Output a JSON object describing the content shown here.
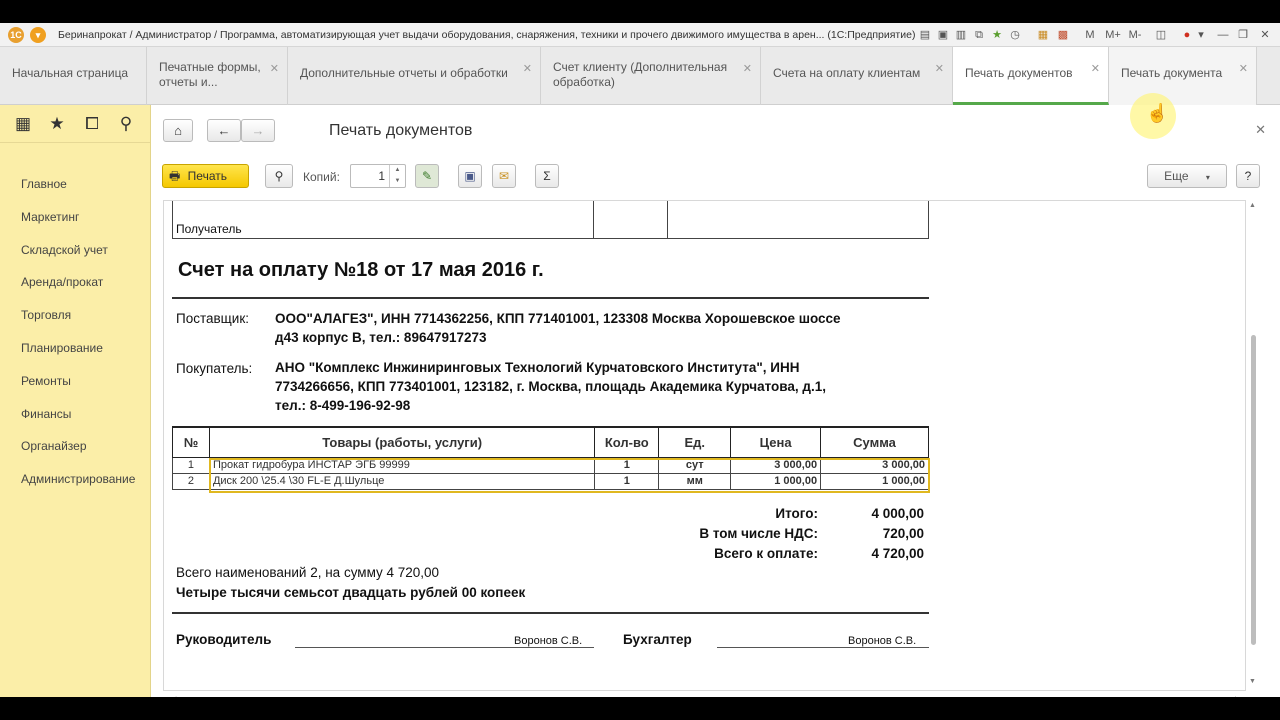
{
  "window": {
    "title": "Беринапрокат / Администратор / Программа, автоматизирующая учет выдачи оборудования, снаряжения, техники и прочего движимого имущества в арен... (1С:Предприятие)",
    "title_icons": [
      "M",
      "M+",
      "M-"
    ]
  },
  "tabs": [
    {
      "label": "Начальная страница"
    },
    {
      "label": "Печатные формы, отчеты и..."
    },
    {
      "label": "Дополнительные отчеты и обработки"
    },
    {
      "label": "Счет клиенту (Дополнительная обработка)"
    },
    {
      "label": "Счета на оплату клиентам"
    },
    {
      "label": "Печать документов"
    },
    {
      "label": "Печать документа"
    }
  ],
  "sidebar": {
    "items": [
      {
        "label": "Главное"
      },
      {
        "label": "Маркетинг"
      },
      {
        "label": "Складской учет"
      },
      {
        "label": "Аренда/прокат"
      },
      {
        "label": "Торговля"
      },
      {
        "label": "Планирование"
      },
      {
        "label": "Ремонты"
      },
      {
        "label": "Финансы"
      },
      {
        "label": "Органайзер"
      },
      {
        "label": "Администрирование"
      }
    ]
  },
  "form": {
    "title": "Печать документов",
    "print_label": "Печать",
    "copies_label": "Копий:",
    "copies_value": "1",
    "more_label": "Еще",
    "help_label": "?"
  },
  "document": {
    "recipient_label": "Получатель",
    "heading": "Счет на оплату №18 от 17 мая 2016 г.",
    "supplier_label": "Поставщик:",
    "supplier_line1": "ООО\"АЛАГЕЗ\", ИНН 7714362256, КПП 771401001, 123308 Москва Хорошевское шоссе",
    "supplier_line2": "д43 корпус В, тел.: 89647917273",
    "buyer_label": "Покупатель:",
    "buyer_line1": "АНО \"Комплекс Инжиниринговых Технологий Курчатовского Института\", ИНН",
    "buyer_line2": "7734266656, КПП 773401001, 123182, г. Москва, площадь Академика Курчатова, д.1,",
    "buyer_line3": "тел.: 8-499-196-92-98",
    "columns": {
      "num": "№",
      "goods": "Товары (работы, услуги)",
      "qty": "Кол-во",
      "unit": "Ед.",
      "price": "Цена",
      "sum": "Сумма"
    },
    "rows": [
      {
        "num": "1",
        "goods": "Прокат гидробура ИНСТАР ЭГБ 99999",
        "qty": "1",
        "unit": "сут",
        "price": "3 000,00",
        "sum": "3 000,00"
      },
      {
        "num": "2",
        "goods": "Диск 200 \\25.4 \\30 FL-E Д.Шульце",
        "qty": "1",
        "unit": "мм",
        "price": "1 000,00",
        "sum": "1 000,00"
      }
    ],
    "totals": [
      {
        "label": "Итого:",
        "value": "4 000,00"
      },
      {
        "label": "В том числе НДС:",
        "value": "720,00"
      },
      {
        "label": "Всего к оплате:",
        "value": "4 720,00"
      }
    ],
    "summary_line": "Всего наименований 2, на сумму 4 720,00",
    "amount_words": "Четыре тысячи семьсот двадцать рублей 00 копеек",
    "director_label": "Руководитель",
    "director_name": "Воронов С.В.",
    "accountant_label": "Бухгалтер",
    "accountant_name": "Воронов С.В."
  }
}
